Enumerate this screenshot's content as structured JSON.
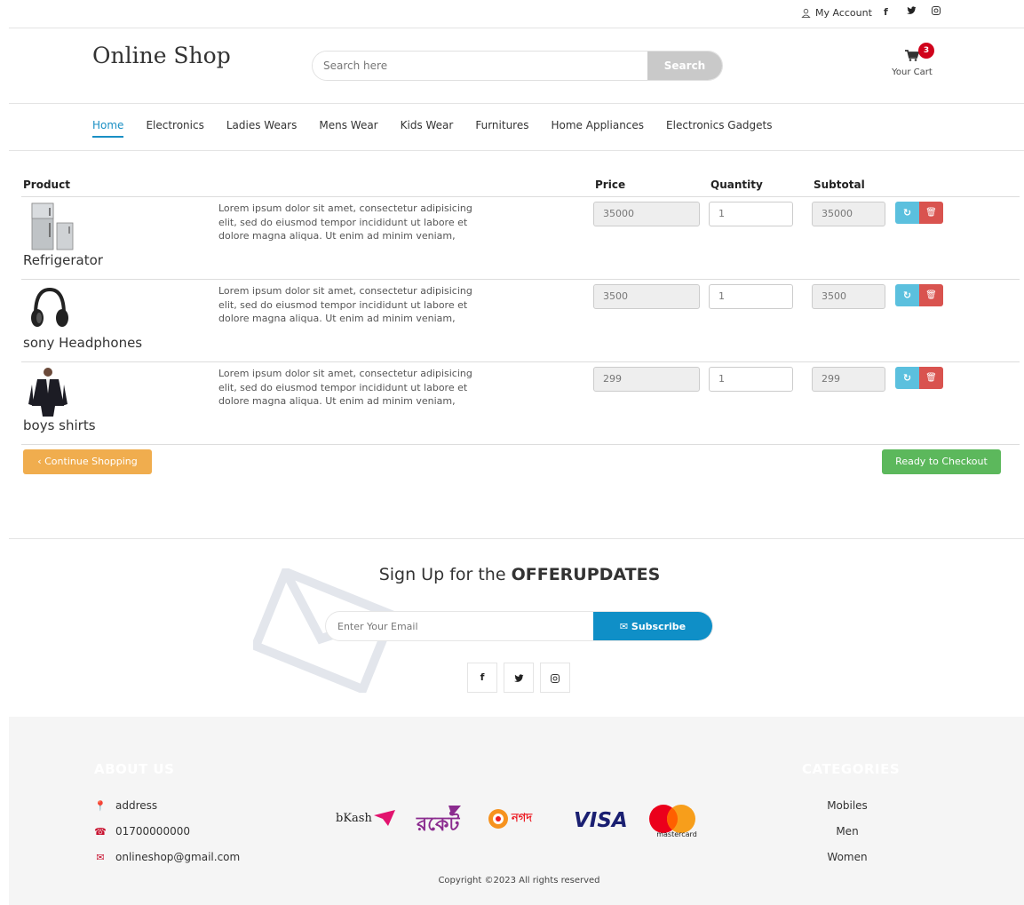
{
  "topbar": {
    "account": "My Account",
    "social": [
      "f",
      "t",
      "i"
    ]
  },
  "header": {
    "logo": "Online Shop",
    "search_placeholder": "Search here",
    "search_button": "Search",
    "cart_count": "3",
    "cart_label": "Your Cart"
  },
  "nav": [
    "Home",
    "Electronics",
    "Ladies Wears",
    "Mens Wear",
    "Kids Wear",
    "Furnitures",
    "Home Appliances",
    "Electronics Gadgets"
  ],
  "cart_table": {
    "headers": {
      "product": "Product",
      "price": "Price",
      "quantity": "Quantity",
      "subtotal": "Subtotal"
    },
    "rows": [
      {
        "name": "Refrigerator",
        "desc": "Lorem ipsum dolor sit amet, consectetur adipisicing elit, sed do eiusmod tempor incididunt ut labore et dolore magna aliqua. Ut enim ad minim veniam,",
        "price": "35000",
        "qty": "1",
        "subtotal": "35000"
      },
      {
        "name": "sony Headphones",
        "desc": "Lorem ipsum dolor sit amet, consectetur adipisicing elit, sed do eiusmod tempor incididunt ut labore et dolore magna aliqua. Ut enim ad minim veniam,",
        "price": "3500",
        "qty": "1",
        "subtotal": "3500"
      },
      {
        "name": "boys shirts",
        "desc": "Lorem ipsum dolor sit amet, consectetur adipisicing elit, sed do eiusmod tempor incididunt ut labore et dolore magna aliqua. Ut enim ad minim veniam,",
        "price": "299",
        "qty": "1",
        "subtotal": "299"
      }
    ]
  },
  "actions": {
    "continue": "‹ Continue Shopping",
    "checkout": "Ready to Checkout"
  },
  "newsletter": {
    "title_prefix": "Sign Up for the ",
    "title_bold": "OFFERUPDATES",
    "placeholder": "Enter Your Email",
    "button": "Subscribe"
  },
  "footer": {
    "about_heading": "ABOUT US",
    "categories_heading": "CATEGORIES",
    "address": "address",
    "phone": "01700000000",
    "email": "onlineshop@gmail.com",
    "categories": [
      "Mobiles",
      "Men",
      "Women"
    ],
    "payments": {
      "bkash": "bKash",
      "nagad": "নগদ",
      "visa": "VISA",
      "mastercard": "mastercard"
    },
    "copyright": "Copyright ©2023 All rights reserved"
  }
}
